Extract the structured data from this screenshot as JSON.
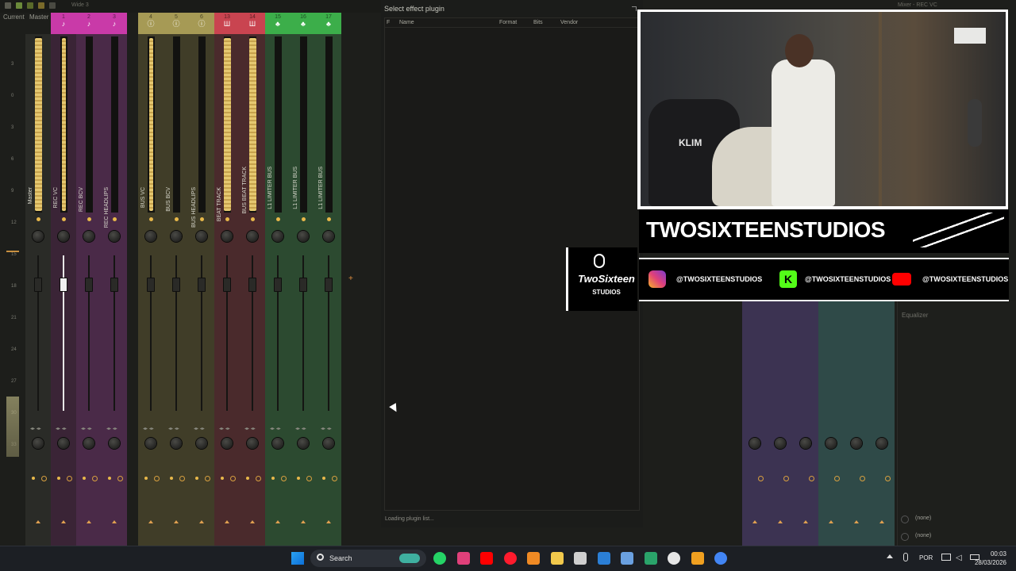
{
  "top_strip": {
    "label": "Wide 3"
  },
  "left_tabs": {
    "current": "Current",
    "master": "Master"
  },
  "db_scale": [
    "3",
    "0",
    "3",
    "6",
    "9",
    "12",
    "15",
    "18",
    "21",
    "24",
    "27",
    "30",
    "33"
  ],
  "channels": [
    {
      "num": "",
      "label": "Master",
      "color": "#2a2b27",
      "head": "#2a2b27",
      "glyph": ""
    },
    {
      "num": "1",
      "label": "REC VC",
      "color": "#3a2436",
      "head": "#c93aa8",
      "glyph": "♪"
    },
    {
      "num": "2",
      "label": "REC BCV",
      "color": "#4a2a48",
      "head": "#c93aa8",
      "glyph": "♪"
    },
    {
      "num": "3",
      "label": "REC HEADLIPS",
      "color": "#4a2a48",
      "head": "#c93aa8",
      "glyph": "♪"
    },
    {
      "num": "4",
      "label": "BUS VC",
      "color": "#403d28",
      "head": "#a69a55",
      "glyph": "ⓘ"
    },
    {
      "num": "5",
      "label": "BUS BCV",
      "color": "#403d28",
      "head": "#a69a55",
      "glyph": "ⓘ"
    },
    {
      "num": "6",
      "label": "BUS HEADLIPS",
      "color": "#403d28",
      "head": "#a69a55",
      "glyph": "ⓘ"
    },
    {
      "num": "13",
      "label": "BEAT TRACK",
      "color": "#4a2a2c",
      "head": "#c94450",
      "glyph": "Ш"
    },
    {
      "num": "14",
      "label": "BUS BEAT TRACK",
      "color": "#4a2a2c",
      "head": "#c94450",
      "glyph": "Ш"
    },
    {
      "num": "15",
      "label": "L1 LIMITER BUS",
      "color": "#2c4a30",
      "head": "#3cae4a",
      "glyph": "♣"
    },
    {
      "num": "16",
      "label": "L1 LIMITER BUS",
      "color": "#2c4a30",
      "head": "#3cae4a",
      "glyph": "♣"
    },
    {
      "num": "17",
      "label": "L1 LIMITER BUS",
      "color": "#2c4a30",
      "head": "#3cae4a",
      "glyph": "♣"
    }
  ],
  "plugin_panel": {
    "title": "Select effect plugin",
    "columns": {
      "f": "F",
      "name": "Name",
      "format": "Format",
      "bits": "Bits",
      "vendor": "Vendor"
    },
    "status": "Loading plugin list..."
  },
  "overlay": {
    "brand": "TWOSIXTEENSTUDIOS",
    "logo_line1": "TwoSixteen",
    "logo_line2": "STUDIOS",
    "cam_brand": "KLIM",
    "socials": [
      {
        "icon": "instagram-icon",
        "handle": "@TWOSIXTEENSTUDIOS",
        "color": "#e0407a"
      },
      {
        "icon": "kick-icon",
        "handle": "@TWOSIXTEENSTUDIOS",
        "color": "#53fc18"
      },
      {
        "icon": "youtube-icon",
        "handle": "@TWOSIXTEENSTUDIOS",
        "color": "#ff0000"
      }
    ]
  },
  "mixer_window_title": "Mixer - REC VC",
  "right_panel": {
    "equalizer": "Equalizer",
    "slot1": "(none)",
    "slot2": "(none)"
  },
  "taskbar": {
    "search": "Search",
    "lang": "POR",
    "time": "00:03",
    "date": "28/03/2026",
    "apps": [
      "whatsapp-icon",
      "instagram-icon",
      "youtube-icon",
      "opera-icon",
      "fl-studio-icon",
      "file-explorer-icon",
      "spotify-icon",
      "vscode-icon",
      "notepad-icon",
      "mail-icon",
      "obs-icon",
      "fl-studio-icon",
      "chrome-icon"
    ]
  }
}
